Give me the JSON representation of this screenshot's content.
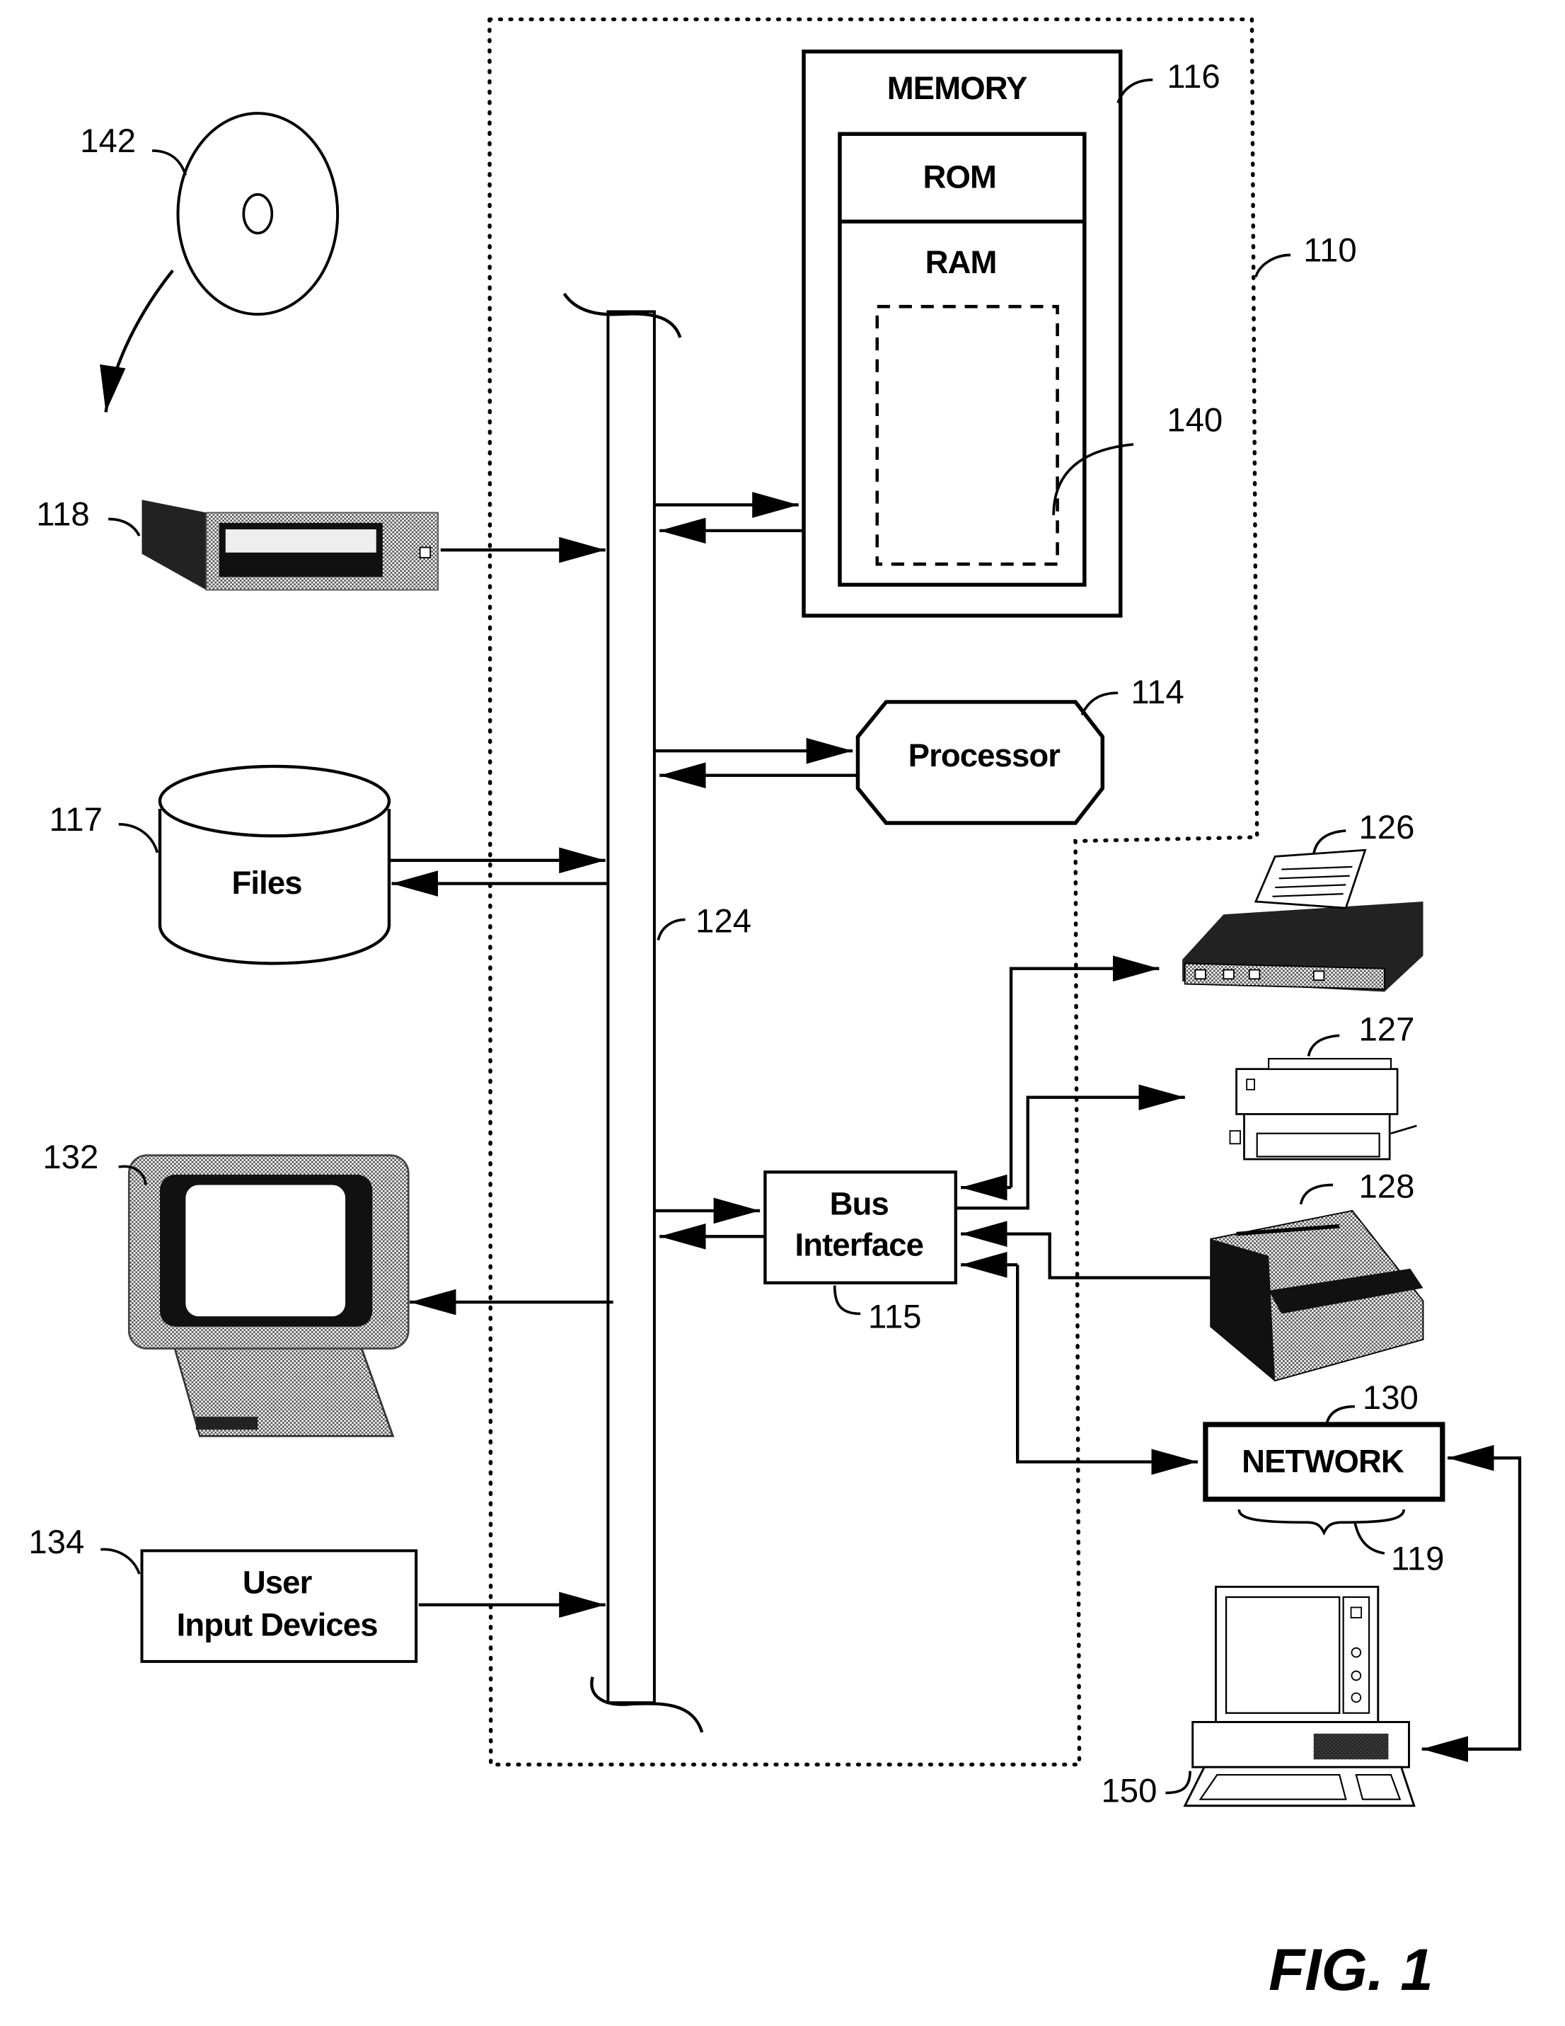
{
  "figure": {
    "title": "FIG. 1",
    "type": "patent block diagram"
  },
  "system": {
    "ref": "110"
  },
  "memory": {
    "label": "MEMORY",
    "ref": "116",
    "rom_label": "ROM",
    "ram_label": "RAM",
    "program_ref": "140"
  },
  "processor": {
    "label": "Processor",
    "ref": "114"
  },
  "bus": {
    "ref": "124"
  },
  "bus_interface": {
    "label_line1": "Bus",
    "label_line2": "Interface",
    "ref": "115"
  },
  "storage_media": {
    "ref": "142",
    "icon": "optical-disc-icon"
  },
  "drive": {
    "ref": "118",
    "icon": "disk-drive-icon"
  },
  "files": {
    "label": "Files",
    "ref": "117",
    "icon": "database-cylinder-icon"
  },
  "display": {
    "ref": "132",
    "icon": "monitor-icon"
  },
  "user_input": {
    "label_line1": "User",
    "label_line2": "Input Devices",
    "ref": "134"
  },
  "printers": [
    {
      "ref": "126",
      "icon": "dot-matrix-printer-icon"
    },
    {
      "ref": "127",
      "icon": "laser-printer-icon"
    },
    {
      "ref": "128",
      "icon": "plotter-printer-icon"
    }
  ],
  "network": {
    "label": "NETWORK",
    "ref": "130",
    "brace_ref": "119"
  },
  "remote_computer": {
    "ref": "150",
    "icon": "desktop-computer-icon"
  }
}
